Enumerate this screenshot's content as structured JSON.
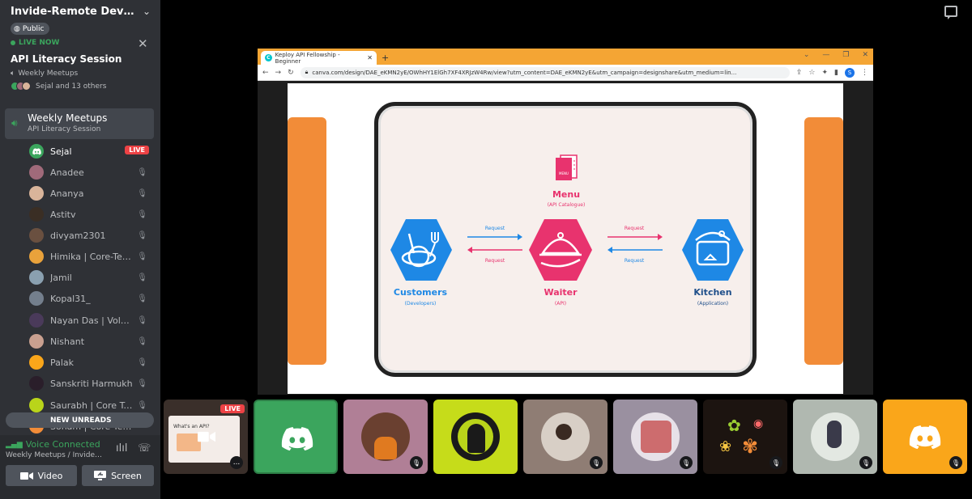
{
  "server": {
    "name": "Invide-Remote Develop...",
    "visibility": "Public"
  },
  "stage": {
    "live_label": "LIVE NOW",
    "title": "API Literacy Session",
    "channel": "Weekly Meetups",
    "attendees": "Sejal and 13 others"
  },
  "channel": {
    "name": "Weekly Meetups",
    "topic": "API Literacy Session"
  },
  "members": [
    {
      "name": "Sejal",
      "live": "LIVE",
      "color": "#3ba55d"
    },
    {
      "name": "Anadee",
      "color": "#a06a7a"
    },
    {
      "name": "Ananya",
      "color": "#d9b49a"
    },
    {
      "name": "Astitv",
      "color": "#3a2e24"
    },
    {
      "name": "divyam2301",
      "color": "#6a5040"
    },
    {
      "name": "Himika | Core-Team",
      "color": "#e9a23b"
    },
    {
      "name": "Jamil",
      "color": "#8aa0b0"
    },
    {
      "name": "Kopal31_",
      "color": "#747f8d"
    },
    {
      "name": "Nayan Das | Volunt...",
      "color": "#4a3a5a"
    },
    {
      "name": "Nishant",
      "color": "#c9a090"
    },
    {
      "name": "Palak",
      "color": "#faa61a"
    },
    {
      "name": "Sanskriti Harmukh",
      "color": "#2a1e2a"
    },
    {
      "name": "Saurabh | Core Team",
      "color": "#b9d41a"
    },
    {
      "name": "Sonam | Core Team",
      "color": "#f28c38"
    }
  ],
  "new_unreads": "NEW UNREADS",
  "voice": {
    "status": "Voice Connected",
    "location": "Weekly Meetups / Invide-R...",
    "video_label": "Video",
    "screen_label": "Screen"
  },
  "browser": {
    "tab_title": "Keploy API Fellowship - Beginner",
    "url": "canva.com/design/DAE_eKMN2yE/OWhHY1ElGh7XF4XRJzW4Rw/view?utm_content=DAE_eKMN2yE&utm_campaign=designshare&utm_medium=lin...",
    "account_initial": "S"
  },
  "slide": {
    "menu_badge": "MENU",
    "menu_title": "Menu",
    "menu_sub": "(API Catalogue)",
    "customers_title": "Customers",
    "customers_sub": "(Developers)",
    "waiter_title": "Waiter",
    "waiter_sub": "(API)",
    "kitchen_title": "Kitchen",
    "kitchen_sub": "(Application)",
    "request_label": "Request",
    "colors": {
      "blue": "#1e88e5",
      "pink": "#e8336e",
      "navy": "#1f4f8a",
      "orange": "#f28c38"
    }
  },
  "thumbnails": {
    "live_badge": "LIVE",
    "preview_text": "What's an API?",
    "more_label": "..."
  },
  "colors": {
    "sidebar": "#2f3136",
    "green": "#3ba55d",
    "red": "#ed4245",
    "discord_blue": "#5865f2"
  }
}
